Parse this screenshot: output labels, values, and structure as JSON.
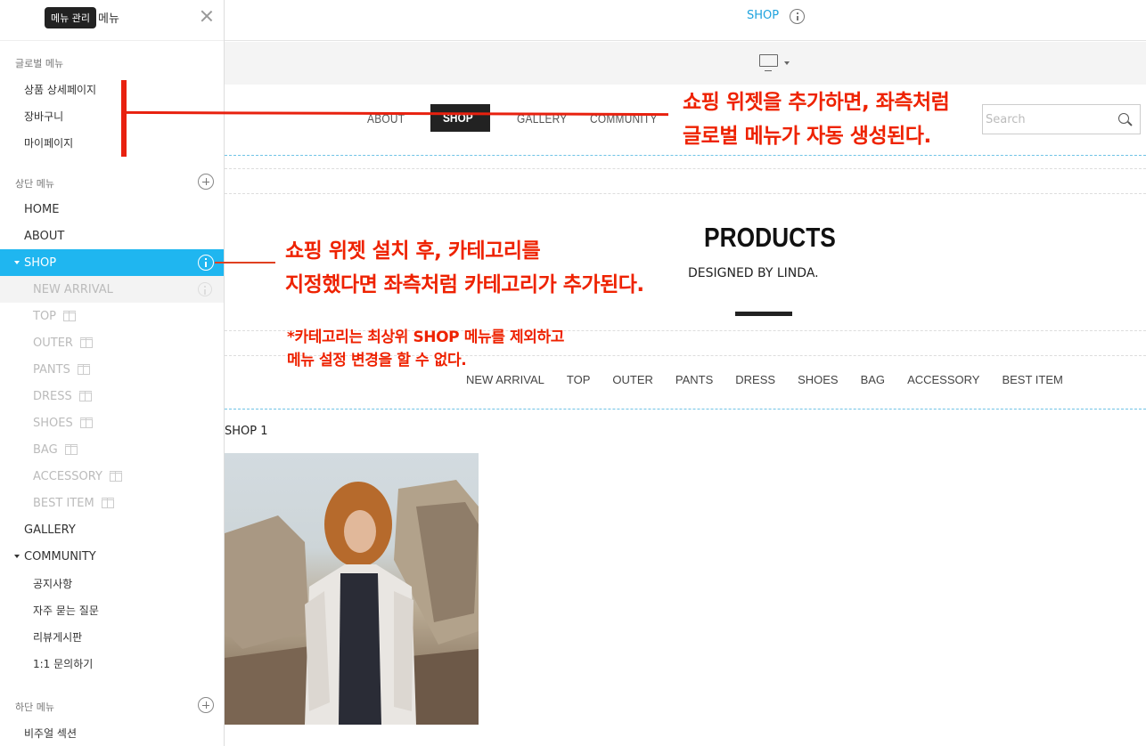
{
  "sidebar": {
    "title": "메뉴",
    "tooltip": "메뉴 관리",
    "global_label": "글로벌 메뉴",
    "global_items": [
      "상품 상세페이지",
      "장바구니",
      "마이페이지"
    ],
    "top_label": "상단 메뉴",
    "top_items": {
      "home": "HOME",
      "about": "ABOUT",
      "shop": "SHOP",
      "shop_children": [
        "NEW ARRIVAL",
        "TOP",
        "OUTER",
        "PANTS",
        "DRESS",
        "SHOES",
        "BAG",
        "ACCESSORY",
        "BEST ITEM"
      ],
      "gallery": "GALLERY",
      "community": "COMMUNITY",
      "community_children": [
        "공지사항",
        "자주 묻는 질문",
        "리뷰게시판",
        "1:1 문의하기"
      ]
    },
    "bottom_label": "하단 메뉴",
    "bottom_items": [
      "비주얼 섹션"
    ]
  },
  "topbar": {
    "page_name": "SHOP"
  },
  "site": {
    "nav": [
      "ABOUT",
      "SHOP",
      "GALLERY",
      "COMMUNITY"
    ],
    "search_placeholder": "Search",
    "products_title": "PRODUCTS",
    "products_subtitle": "DESIGNED BY LINDA.",
    "categories": [
      "NEW ARRIVAL",
      "TOP",
      "OUTER",
      "PANTS",
      "DRESS",
      "SHOES",
      "BAG",
      "ACCESSORY",
      "BEST ITEM"
    ],
    "shop_label": "SHOP 1"
  },
  "annotations": {
    "note1": [
      "쇼핑 위젯을 추가하면, 좌측처럼",
      "글로벌 메뉴가 자동 생성된다."
    ],
    "note2": [
      "쇼핑 위젯 설치 후, 카테고리를",
      "지정했다면 좌측처럼 카테고리가 추가된다."
    ],
    "note3": [
      "*카테고리는 최상위 SHOP 메뉴를 제외하고",
      "메뉴 설정 변경을 할 수 없다."
    ]
  },
  "colors": {
    "accent": "#1fb6f0",
    "annotation": "#ee2200",
    "shop_nav_bg": "#222222"
  }
}
